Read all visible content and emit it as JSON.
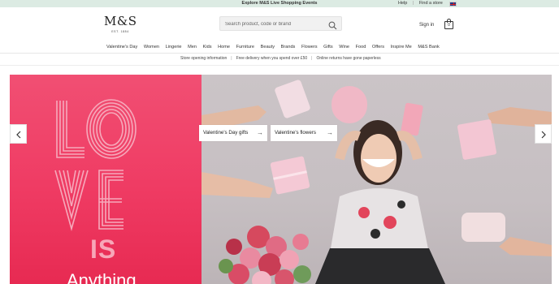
{
  "topbar": {
    "promo": "Explore M&S Live Shopping Events",
    "help": "Help",
    "separator": "|",
    "find_store": "Find a store"
  },
  "header": {
    "logo": "M&S",
    "logo_est": "EST. 1884",
    "search_placeholder": "Search product, code or brand",
    "sign_in": "Sign in",
    "bag_count": "0"
  },
  "nav": {
    "items": [
      "Valentine's Day",
      "Women",
      "Lingerie",
      "Men",
      "Kids",
      "Home",
      "Furniture",
      "Beauty",
      "Brands",
      "Flowers",
      "Gifts",
      "Wine",
      "Food",
      "Offers",
      "Inspire Me",
      "M&S Bank"
    ]
  },
  "infobar": {
    "items": [
      "Store opening information",
      "Free delivery when you spend over £50",
      "Online returns have gone paperless"
    ],
    "separator": "|"
  },
  "hero": {
    "headline_love": "LOVE",
    "headline_is": "IS",
    "headline_anything": "Anything",
    "link1": "Valentine's Day gifts",
    "link2": "Valentine's flowers",
    "arrow": "→"
  },
  "colors": {
    "topbar_bg": "#dcebe3",
    "hero_pink": "#ef3b63",
    "love_stroke": "#f5a3b6",
    "photo_bg": "#c6bfc2"
  },
  "icons": {
    "search": "search-icon",
    "bag": "bag-icon",
    "flag": "uk-flag-icon",
    "prev": "chevron-left-icon",
    "next": "chevron-right-icon"
  }
}
